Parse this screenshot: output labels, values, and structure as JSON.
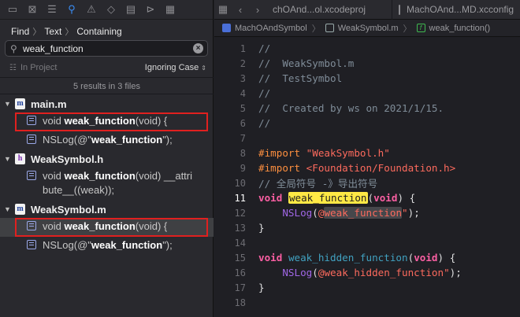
{
  "navigator": {
    "toolbar_icons": [
      "folder-icon",
      "source-control-icon",
      "bookmark-icon",
      "find-icon",
      "issue-icon",
      "test-icon",
      "debug-icon",
      "breakpoint-icon",
      "report-icon"
    ],
    "find_bar": {
      "mode": "Find",
      "target": "Text",
      "match": "Containing"
    },
    "search": {
      "value": "weak_function",
      "placeholder": ""
    },
    "scope": {
      "label": "In Project",
      "case_option": "Ignoring Case"
    },
    "results_count": "5 results in 3 files",
    "results": [
      {
        "file": "main.m",
        "file_icon": "m",
        "matches": [
          {
            "before": "void ",
            "match": "weak_function",
            "after": "(void) {",
            "selected": false,
            "boxed": true
          },
          {
            "before": "NSLog(@\"",
            "match": "weak_function",
            "after": "\");",
            "selected": false,
            "boxed": false
          }
        ]
      },
      {
        "file": "WeakSymbol.h",
        "file_icon": "h",
        "matches": [
          {
            "before": "void ",
            "match": "weak_function",
            "after": "(void)  __attri",
            "line2": "bute__((weak));",
            "selected": false,
            "boxed": false
          }
        ]
      },
      {
        "file": "WeakSymbol.m",
        "file_icon": "m",
        "matches": [
          {
            "before": "void ",
            "match": "weak_function",
            "after": "(void) {",
            "selected": true,
            "boxed": true
          },
          {
            "before": "NSLog(@\"",
            "match": "weak_function",
            "after": "\");",
            "selected": false,
            "boxed": false
          }
        ]
      }
    ]
  },
  "editor": {
    "tabs": [
      {
        "label": "chOAnd...ol.xcodeproj"
      },
      {
        "label": "MachOAnd...MD.xcconfig"
      }
    ],
    "jumpbar": {
      "project": "MachOAndSymbol",
      "file": "WeakSymbol.m",
      "function": "weak_function()"
    },
    "current_line": 11,
    "lines": [
      {
        "n": 1,
        "text": "//"
      },
      {
        "n": 2,
        "text": "//  WeakSymbol.m"
      },
      {
        "n": 3,
        "text": "//  TestSymbol"
      },
      {
        "n": 4,
        "text": "//"
      },
      {
        "n": 5,
        "text": "//  Created by ws on 2021/1/15."
      },
      {
        "n": 6,
        "text": "//"
      },
      {
        "n": 7,
        "text": ""
      },
      {
        "n": 8,
        "text": "#import \"WeakSymbol.h\""
      },
      {
        "n": 9,
        "text": "#import <Foundation/Foundation.h>"
      },
      {
        "n": 10,
        "text": "// 全局符号 -》导出符号"
      },
      {
        "n": 11,
        "text": "void weak_function(void) {"
      },
      {
        "n": 12,
        "text": "    NSLog(@\"weak_function\");"
      },
      {
        "n": 13,
        "text": "}"
      },
      {
        "n": 14,
        "text": ""
      },
      {
        "n": 15,
        "text": "void weak_hidden_function(void) {"
      },
      {
        "n": 16,
        "text": "    NSLog(@\"weak_hidden_function\");"
      },
      {
        "n": 17,
        "text": "}"
      },
      {
        "n": 18,
        "text": ""
      }
    ],
    "colors": {
      "keyword": "#fc5fa3",
      "preprocessor": "#fd8f3f",
      "string": "#fc6a5d",
      "comment": "#7f8c98",
      "function_decl": "#41a1c0",
      "function_call": "#a167e6",
      "find_highlight": "#ffe945",
      "annotation_box": "#e0201f"
    }
  }
}
